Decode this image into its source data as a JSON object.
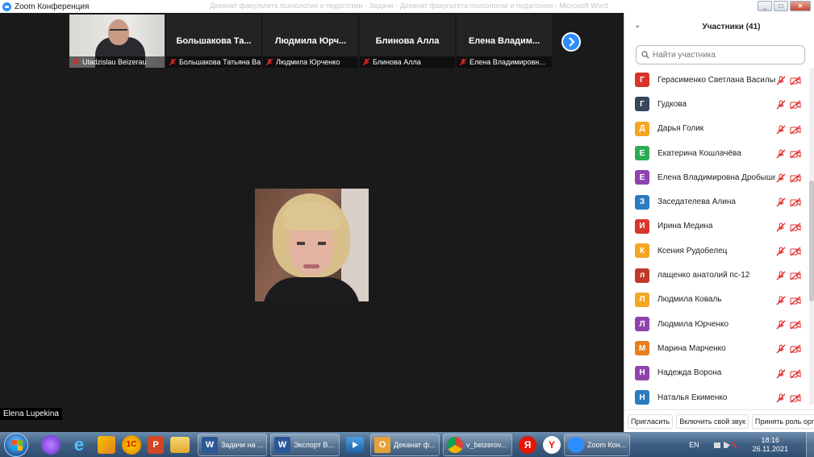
{
  "window": {
    "title": "Zoom Конференция",
    "background_title": "Деканат факультета психологии и педагогики - Задачи - Деканат факультета психологии и педагогики - Microsoft Word"
  },
  "gallery": {
    "thumbnails": [
      {
        "caption": "Uladzislau  Beizerau",
        "display_name": "",
        "has_video": true
      },
      {
        "caption": "Большакова Татьяна Ва...",
        "display_name": "Большакова  Та...",
        "has_video": false
      },
      {
        "caption": "Людмила Юрченко",
        "display_name": "Людмила  Юрч...",
        "has_video": false
      },
      {
        "caption": "Блинова Алла",
        "display_name": "Блинова Алла",
        "has_video": false
      },
      {
        "caption": "Елена Владимировн...",
        "display_name": "Елена  Владим...",
        "has_video": false
      }
    ],
    "next_icon": "chevron-right-icon"
  },
  "speaker": {
    "name": "Elena Lupekina"
  },
  "participants": {
    "title": "Участники (41)",
    "search_placeholder": "Найти участника",
    "items": [
      {
        "initial": "Г",
        "color": "#d9362b",
        "name": "Герасименко Светлана Васильевна"
      },
      {
        "initial": "Г",
        "color": "#37475a",
        "name": "Гудкова"
      },
      {
        "initial": "Д",
        "color": "#f5a623",
        "name": "Дарья Голик"
      },
      {
        "initial": "Е",
        "color": "#2eaa55",
        "name": "Екатерина Кошлачёва"
      },
      {
        "initial": "Е",
        "color": "#8e44ad",
        "name": "Елена Владимировна Дробышевская"
      },
      {
        "initial": "З",
        "color": "#2b7bbf",
        "name": "Заседателева Алина"
      },
      {
        "initial": "И",
        "color": "#d9362b",
        "name": "Ирина Медина"
      },
      {
        "initial": "К",
        "color": "#f5a623",
        "name": "Ксения Рудобелец"
      },
      {
        "initial": "л",
        "color": "#c0392b",
        "name": "лащенко анатолий пс-12"
      },
      {
        "initial": "Л",
        "color": "#f5a623",
        "name": "Людмила  Коваль"
      },
      {
        "initial": "Л",
        "color": "#8e44ad",
        "name": "Людмила Юрченко"
      },
      {
        "initial": "М",
        "color": "#e67e22",
        "name": "Марина Марченко"
      },
      {
        "initial": "Н",
        "color": "#8e44ad",
        "name": "Надежда Ворона"
      },
      {
        "initial": "Н",
        "color": "#2b7bbf",
        "name": "Наталья Екименко"
      }
    ],
    "footer": {
      "invite": "Пригласить",
      "unmute": "Включить свой звук",
      "claim_host": "Принять роль орга"
    }
  },
  "taskbar": {
    "tasks": [
      {
        "label": "Задачи на ...",
        "icon_letter": "W",
        "icon_color": "#2b5797"
      },
      {
        "label": "Экспорт В...",
        "icon_letter": "W",
        "icon_color": "#2b5797"
      },
      {
        "label": "Деканат ф...",
        "icon_letter": "O",
        "icon_color": "#e5a13a"
      },
      {
        "label": "v_beizerov...",
        "icon_letter": "",
        "icon_color": "#db4437"
      },
      {
        "label": "Zoom Кон...",
        "icon_letter": "",
        "icon_color": "#2d8cff"
      }
    ],
    "lang": "EN",
    "time": "18:16",
    "date": "26.11.2021"
  }
}
